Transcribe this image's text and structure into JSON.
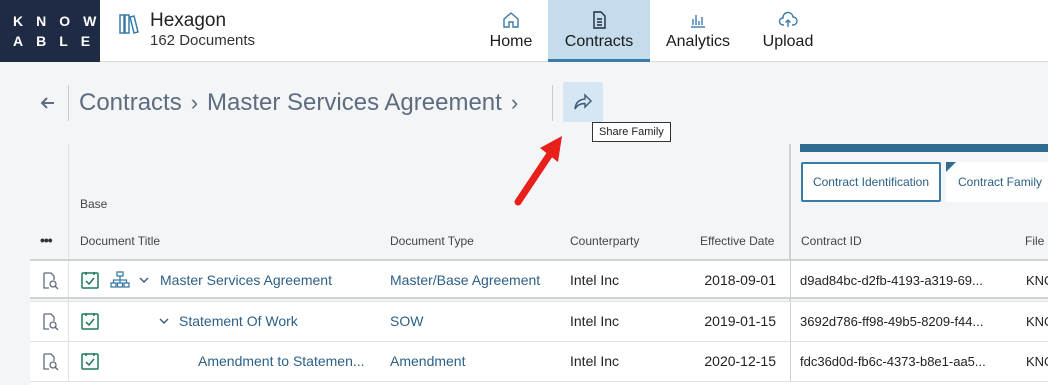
{
  "brand": {
    "line1": "KNOW",
    "line2": "ABLE"
  },
  "workspace": {
    "name": "Hexagon",
    "count": "162 Documents"
  },
  "nav": {
    "home": "Home",
    "contracts": "Contracts",
    "analytics": "Analytics",
    "upload": "Upload"
  },
  "breadcrumb": {
    "root": "Contracts",
    "current": "Master Services Agreement"
  },
  "share": {
    "tooltip": "Share Family"
  },
  "table": {
    "group_label": "Base",
    "headers": {
      "title": "Document Title",
      "type": "Document Type",
      "counterparty": "Counterparty",
      "date": "Effective Date",
      "contract_id": "Contract ID",
      "file": "File"
    },
    "right_tabs": {
      "identification": "Contract Identification",
      "family": "Contract Family"
    },
    "rows": [
      {
        "title": "Master Services Agreement",
        "type": "Master/Base Agreement",
        "counterparty": "Intel Inc",
        "date": "2018-09-01",
        "contract_id": "d9ad84bc-d2fb-4193-a319-69...",
        "file": "KNO"
      },
      {
        "title": "Statement Of Work",
        "type": "SOW",
        "counterparty": "Intel Inc",
        "date": "2019-01-15",
        "contract_id": "3692d786-ff98-49b5-8209-f44...",
        "file": "KNO"
      },
      {
        "title": "Amendment to Statemen...",
        "type": "Amendment",
        "counterparty": "Intel Inc",
        "date": "2020-12-15",
        "contract_id": "fdc36d0d-fb6c-4373-b8e1-aa5...",
        "file": "KNO"
      }
    ]
  },
  "colors": {
    "brand_dark": "#1f2a44",
    "accent": "#3a7ba8",
    "link": "#2b5f86",
    "active_tab_bg": "#c5dcec",
    "annotation_arrow": "#e8201c"
  },
  "icons": {
    "workspace": "books-icon",
    "home": "home-icon",
    "contracts": "document-icon",
    "analytics": "bar-chart-icon",
    "upload": "cloud-upload-icon",
    "back": "arrow-left-icon",
    "share": "share-arrow-icon"
  }
}
